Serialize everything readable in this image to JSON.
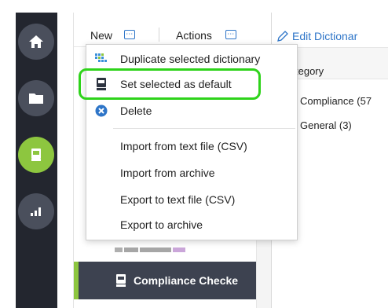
{
  "toolbar": {
    "new_label": "New",
    "actions_label": "Actions",
    "more_glyph": "…"
  },
  "rail": {
    "icons": [
      "home-icon",
      "folder-icon",
      "dictionary-icon",
      "reports-icon"
    ],
    "active": "dictionary-icon",
    "accent_color": "#8dc63f"
  },
  "menu": {
    "items": [
      {
        "label": "Duplicate selected dictionary",
        "icon": "duplicate-grid-icon"
      },
      {
        "label": "Set selected as default",
        "icon": "book-icon"
      },
      {
        "label": "Delete",
        "icon": "delete-x-icon"
      },
      {
        "label": "Import from text file (CSV)"
      },
      {
        "label": "Import from archive"
      },
      {
        "label": "Export to text file (CSV)"
      },
      {
        "label": "Export to archive"
      }
    ],
    "highlight_color": "#2ed31a"
  },
  "list": {
    "selected_label": "Compliance Checke"
  },
  "right": {
    "edit_label": "Edit Dictionar",
    "category_header": "tegory",
    "categories": [
      "Compliance (57",
      "General (3)"
    ],
    "link_color": "#2e75c8"
  }
}
